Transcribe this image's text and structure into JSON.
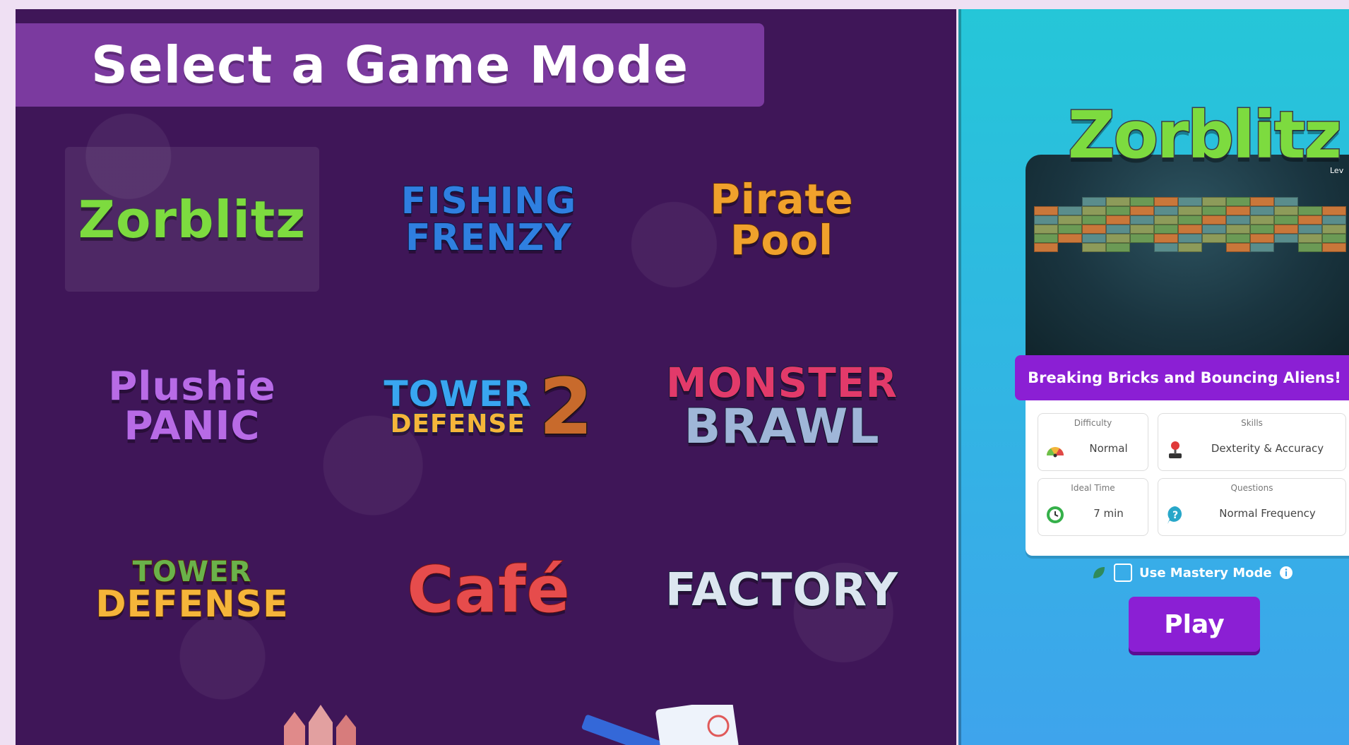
{
  "header": {
    "title": "Select a Game Mode"
  },
  "games": [
    {
      "line1": "Zorblitz",
      "line2": "",
      "color": "#7ddb3f",
      "stroke": "#3b3f4a",
      "selected": true
    },
    {
      "line1": "FISHING",
      "line2": "FRENZY",
      "color": "#2f7fe0",
      "stroke": "#0e1a4a"
    },
    {
      "line1": "Pirate",
      "line2": "Pool",
      "color": "#f0a12c",
      "stroke": "#5b2a12"
    },
    {
      "line1": "Plushie",
      "line2": "PANIC",
      "color": "#b86be6",
      "stroke": "#3a1560"
    },
    {
      "line1": "TOWER",
      "line2": "DEFENSE",
      "badge": "2",
      "color": "#39a6f0",
      "stroke": "#1a2a5a"
    },
    {
      "line1": "MONSTER",
      "line2": "BRAWL",
      "color": "#e23a6a",
      "stroke": "#1a1c3a"
    },
    {
      "line1": "TOWER",
      "line2": "DEFENSE",
      "color": "#f5b53a",
      "stroke": "#5b2a12"
    },
    {
      "line1": "Café",
      "line2": "",
      "color": "#e64c4c",
      "stroke": "#7a1414"
    },
    {
      "line1": "FACTORY",
      "line2": "",
      "color": "#dce6f0",
      "stroke": "#1a2340"
    }
  ],
  "detail": {
    "preview_logo": "Zorblitz",
    "level_label": "Lev",
    "tagline": "Breaking Bricks and Bouncing Aliens!",
    "stats": {
      "difficulty": {
        "label": "Difficulty",
        "value": "Normal"
      },
      "skills": {
        "label": "Skills",
        "value": "Dexterity & Accuracy"
      },
      "ideal_time": {
        "label": "Ideal Time",
        "value": "7 min"
      },
      "questions": {
        "label": "Questions",
        "value": "Normal Frequency"
      }
    },
    "mastery_label": "Use Mastery Mode",
    "play_label": "Play"
  },
  "colors": {
    "accent": "#8b1fd4",
    "panel_bg": "#3f1658",
    "header_bg": "#7b3a9f"
  }
}
